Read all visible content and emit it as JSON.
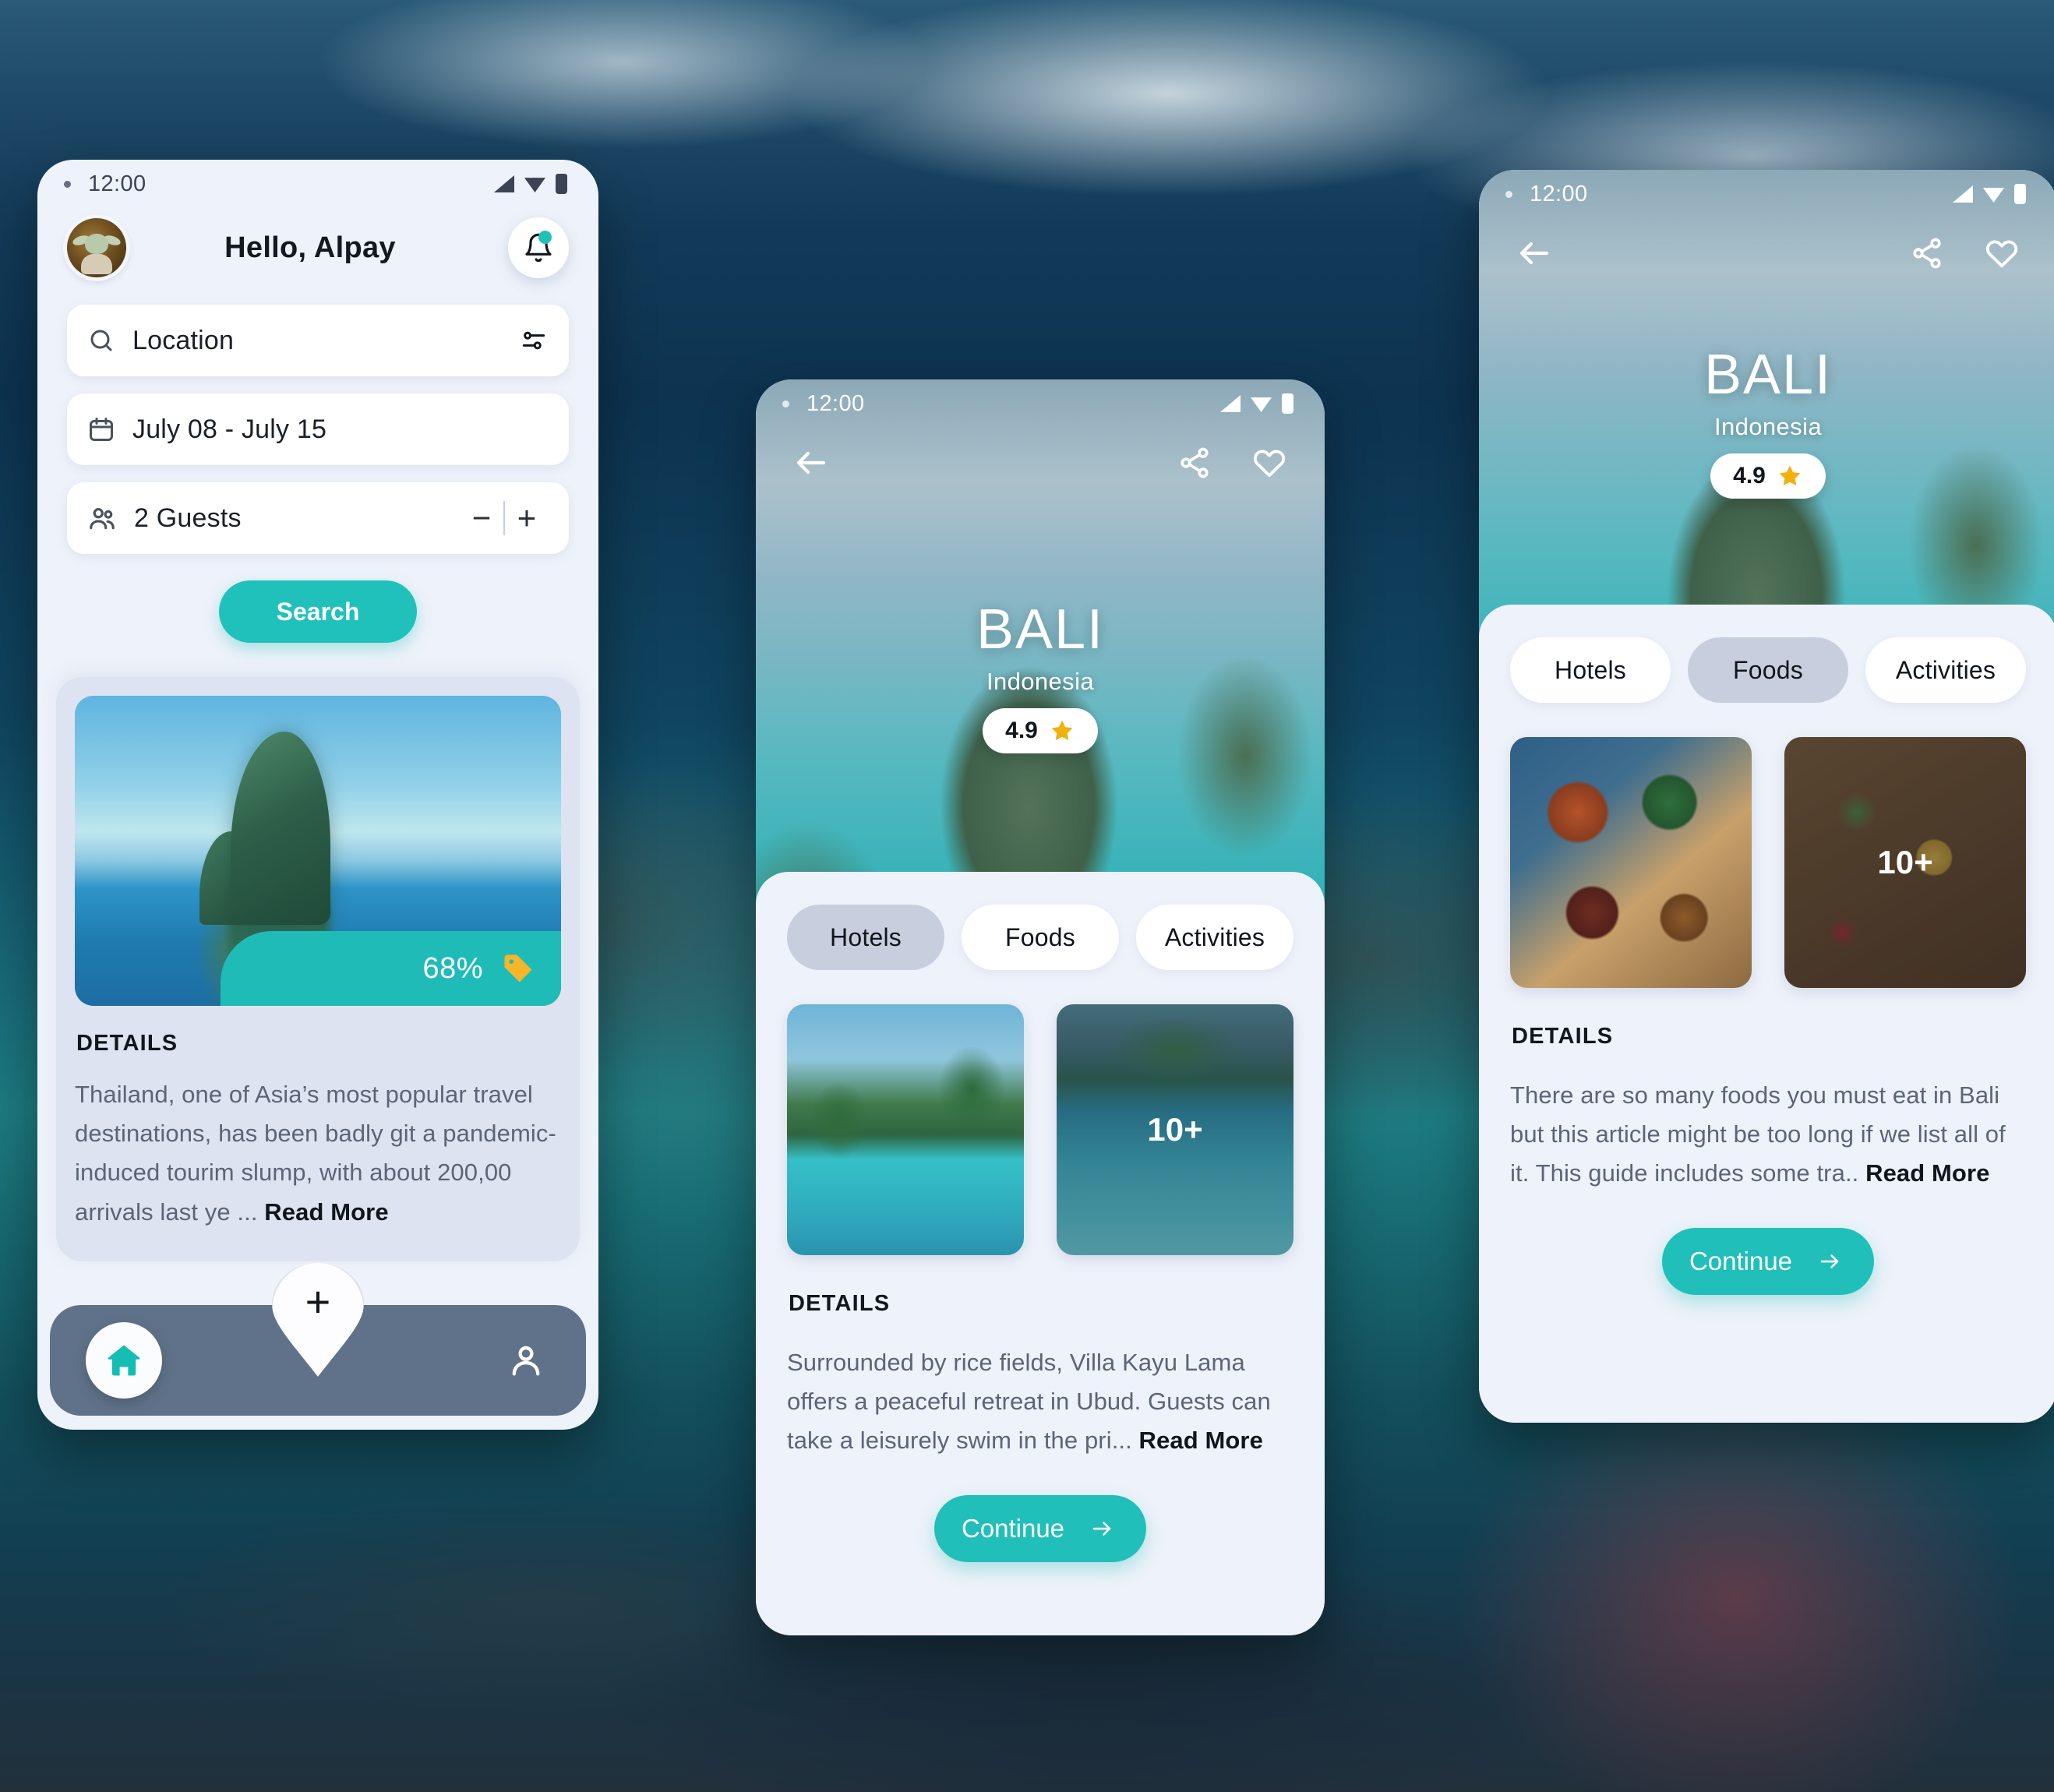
{
  "accent": {
    "teal": "#21c1bb",
    "navy": "#5f7289",
    "card_gray": "#dde3f0",
    "tab_active": "#c7cfdf",
    "star": "#f2b10d"
  },
  "phone1": {
    "status": {
      "time": "12:00"
    },
    "header": {
      "greeting": "Hello,  Alpay",
      "avatar_name": "avatar",
      "bell_name": "notifications"
    },
    "search": {
      "location_value": "Location",
      "location_placeholder": "Location",
      "date_value": "July 08 - July 15",
      "guests_value": "2 Guests",
      "minus_label": "−",
      "plus_label": "+",
      "search_label": "Search"
    },
    "promo": {
      "discount": "68%",
      "details_label": "DETAILS",
      "details_text": "Thailand, one of Asia’s most popular travel destinations, has been badly git a pandemic-induced tourim slump, with about 200,00 arrivals last ye ...",
      "read_more": "Read More"
    },
    "bottomnav": {
      "home_label": "home",
      "add_label": "+",
      "profile_label": "profile"
    }
  },
  "phone2": {
    "status": {
      "time": "12:00"
    },
    "hero": {
      "title": "BALI",
      "subtitle": "Indonesia",
      "rating": "4.9"
    },
    "tabs": [
      {
        "label": "Hotels",
        "active": true
      },
      {
        "label": "Foods",
        "active": false
      },
      {
        "label": "Activities",
        "active": false
      }
    ],
    "thumbs": [
      {
        "overlay": ""
      },
      {
        "overlay": "10+"
      }
    ],
    "details_label": "DETAILS",
    "details_text": "Surrounded by rice fields, Villa Kayu Lama offers a peaceful retreat in Ubud. Guests can take a leisurely swim in the pri...",
    "read_more": "Read More",
    "continue_label": "Continue"
  },
  "phone3": {
    "status": {
      "time": "12:00"
    },
    "hero": {
      "title": "BALI",
      "subtitle": "Indonesia",
      "rating": "4.9"
    },
    "tabs": [
      {
        "label": "Hotels",
        "active": false
      },
      {
        "label": "Foods",
        "active": true
      },
      {
        "label": "Activities",
        "active": false
      }
    ],
    "thumbs": [
      {
        "overlay": ""
      },
      {
        "overlay": "10+"
      }
    ],
    "details_label": "DETAILS",
    "details_text": "There are so many foods you must eat in Bali but this article might be too long if we list all of it. This guide includes some tra..",
    "read_more": "Read More",
    "continue_label": "Continue"
  }
}
